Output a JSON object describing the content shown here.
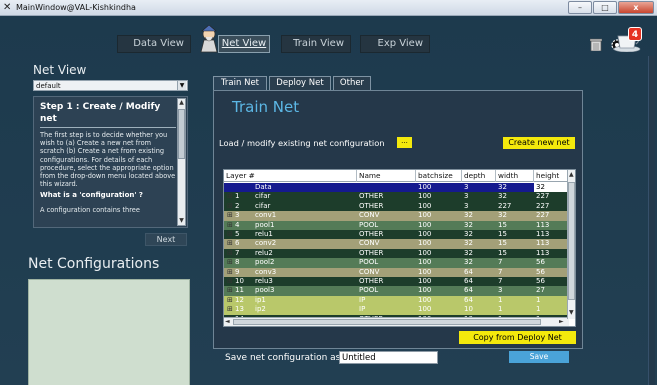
{
  "window": {
    "title": "MainWindow@VAL-Kishkindha",
    "min_glyph": "–",
    "max_glyph": "□",
    "close_glyph": "x"
  },
  "topnav": {
    "data_view": "Data View",
    "net_view": "Net View",
    "train_view": "Train View",
    "exp_view": "Exp View"
  },
  "notifications": {
    "count": "4"
  },
  "sidebar": {
    "title": "Net View",
    "selector_value": "default",
    "step": {
      "title": "Step 1 : Create / Modify net",
      "body": "The first step is to decide whether you wish to (a) Create a new net from scratch (b) Create a net from existing configurations. For details of each procedure, select the appropriate option from the drop-down menu located above this wizard.",
      "question": "What is a 'configuration' ?",
      "cut_text": "A configuration contains three"
    },
    "next_label": "Next",
    "configs_title": "Net Configurations"
  },
  "tabs": [
    {
      "label": "Train Net"
    },
    {
      "label": "Deploy Net"
    },
    {
      "label": "Other"
    }
  ],
  "train_net": {
    "title": "Train Net",
    "load_label": "Load / modify existing net configuration",
    "load_button": "...",
    "create_button": "Create new net",
    "copy_button": "Copy from Deploy Net"
  },
  "table": {
    "columns": [
      "Layer #",
      "Name",
      "batchsize",
      "depth",
      "width",
      "height"
    ],
    "rows": [
      {
        "expander": "",
        "num": "",
        "layer": "Data",
        "name": "",
        "batchsize": "100",
        "depth": "3",
        "width": "32",
        "height": "32",
        "color": "#151a8f"
      },
      {
        "expander": "⊞",
        "num": "1",
        "layer": "cifar",
        "name": "OTHER",
        "batchsize": "100",
        "depth": "3",
        "width": "32",
        "height": "227",
        "color": "#1d3d2b"
      },
      {
        "expander": "⊞",
        "num": "2",
        "layer": "cifar",
        "name": "OTHER",
        "batchsize": "100",
        "depth": "3",
        "width": "227",
        "height": "227",
        "color": "#1d3d2b"
      },
      {
        "expander": "⊞",
        "num": "3",
        "layer": "conv1",
        "name": "CONV",
        "batchsize": "100",
        "depth": "32",
        "width": "32",
        "height": "227",
        "color": "#a3a078"
      },
      {
        "expander": "⊞",
        "num": "4",
        "layer": "pool1",
        "name": "POOL",
        "batchsize": "100",
        "depth": "32",
        "width": "15",
        "height": "113",
        "color": "#547b57"
      },
      {
        "expander": "⊞",
        "num": "5",
        "layer": "relu1",
        "name": "OTHER",
        "batchsize": "100",
        "depth": "32",
        "width": "15",
        "height": "113",
        "color": "#1d3d2b"
      },
      {
        "expander": "⊞",
        "num": "6",
        "layer": "conv2",
        "name": "CONV",
        "batchsize": "100",
        "depth": "32",
        "width": "15",
        "height": "113",
        "color": "#a3a078"
      },
      {
        "expander": "⊞",
        "num": "7",
        "layer": "relu2",
        "name": "OTHER",
        "batchsize": "100",
        "depth": "32",
        "width": "15",
        "height": "113",
        "color": "#1d3d2b"
      },
      {
        "expander": "⊞",
        "num": "8",
        "layer": "pool2",
        "name": "POOL",
        "batchsize": "100",
        "depth": "32",
        "width": "7",
        "height": "56",
        "color": "#547b57"
      },
      {
        "expander": "⊞",
        "num": "9",
        "layer": "conv3",
        "name": "CONV",
        "batchsize": "100",
        "depth": "64",
        "width": "7",
        "height": "56",
        "color": "#a3a078"
      },
      {
        "expander": "⊞",
        "num": "10",
        "layer": "relu3",
        "name": "OTHER",
        "batchsize": "100",
        "depth": "64",
        "width": "7",
        "height": "56",
        "color": "#1d3d2b"
      },
      {
        "expander": "⊞",
        "num": "11",
        "layer": "pool3",
        "name": "POOL",
        "batchsize": "100",
        "depth": "64",
        "width": "3",
        "height": "27",
        "color": "#547b57"
      },
      {
        "expander": "⊞",
        "num": "12",
        "layer": "ip1",
        "name": "IP",
        "batchsize": "100",
        "depth": "64",
        "width": "1",
        "height": "1",
        "color": "#b9c86a"
      },
      {
        "expander": "⊞",
        "num": "13",
        "layer": "ip2",
        "name": "IP",
        "batchsize": "100",
        "depth": "10",
        "width": "1",
        "height": "1",
        "color": "#b9c86a"
      },
      {
        "expander": "⊞",
        "num": "14",
        "layer": "accuracy",
        "name": "OTHER",
        "batchsize": "100",
        "depth": "10",
        "width": "1",
        "height": "1",
        "color": "#1d3d2b"
      }
    ]
  },
  "save": {
    "label": "Save net configuration as",
    "value": "Untitled",
    "button": "Save"
  },
  "icons": {
    "scroll_up": "▲",
    "scroll_down": "▼",
    "scroll_left": "◄",
    "scroll_right": "►"
  }
}
